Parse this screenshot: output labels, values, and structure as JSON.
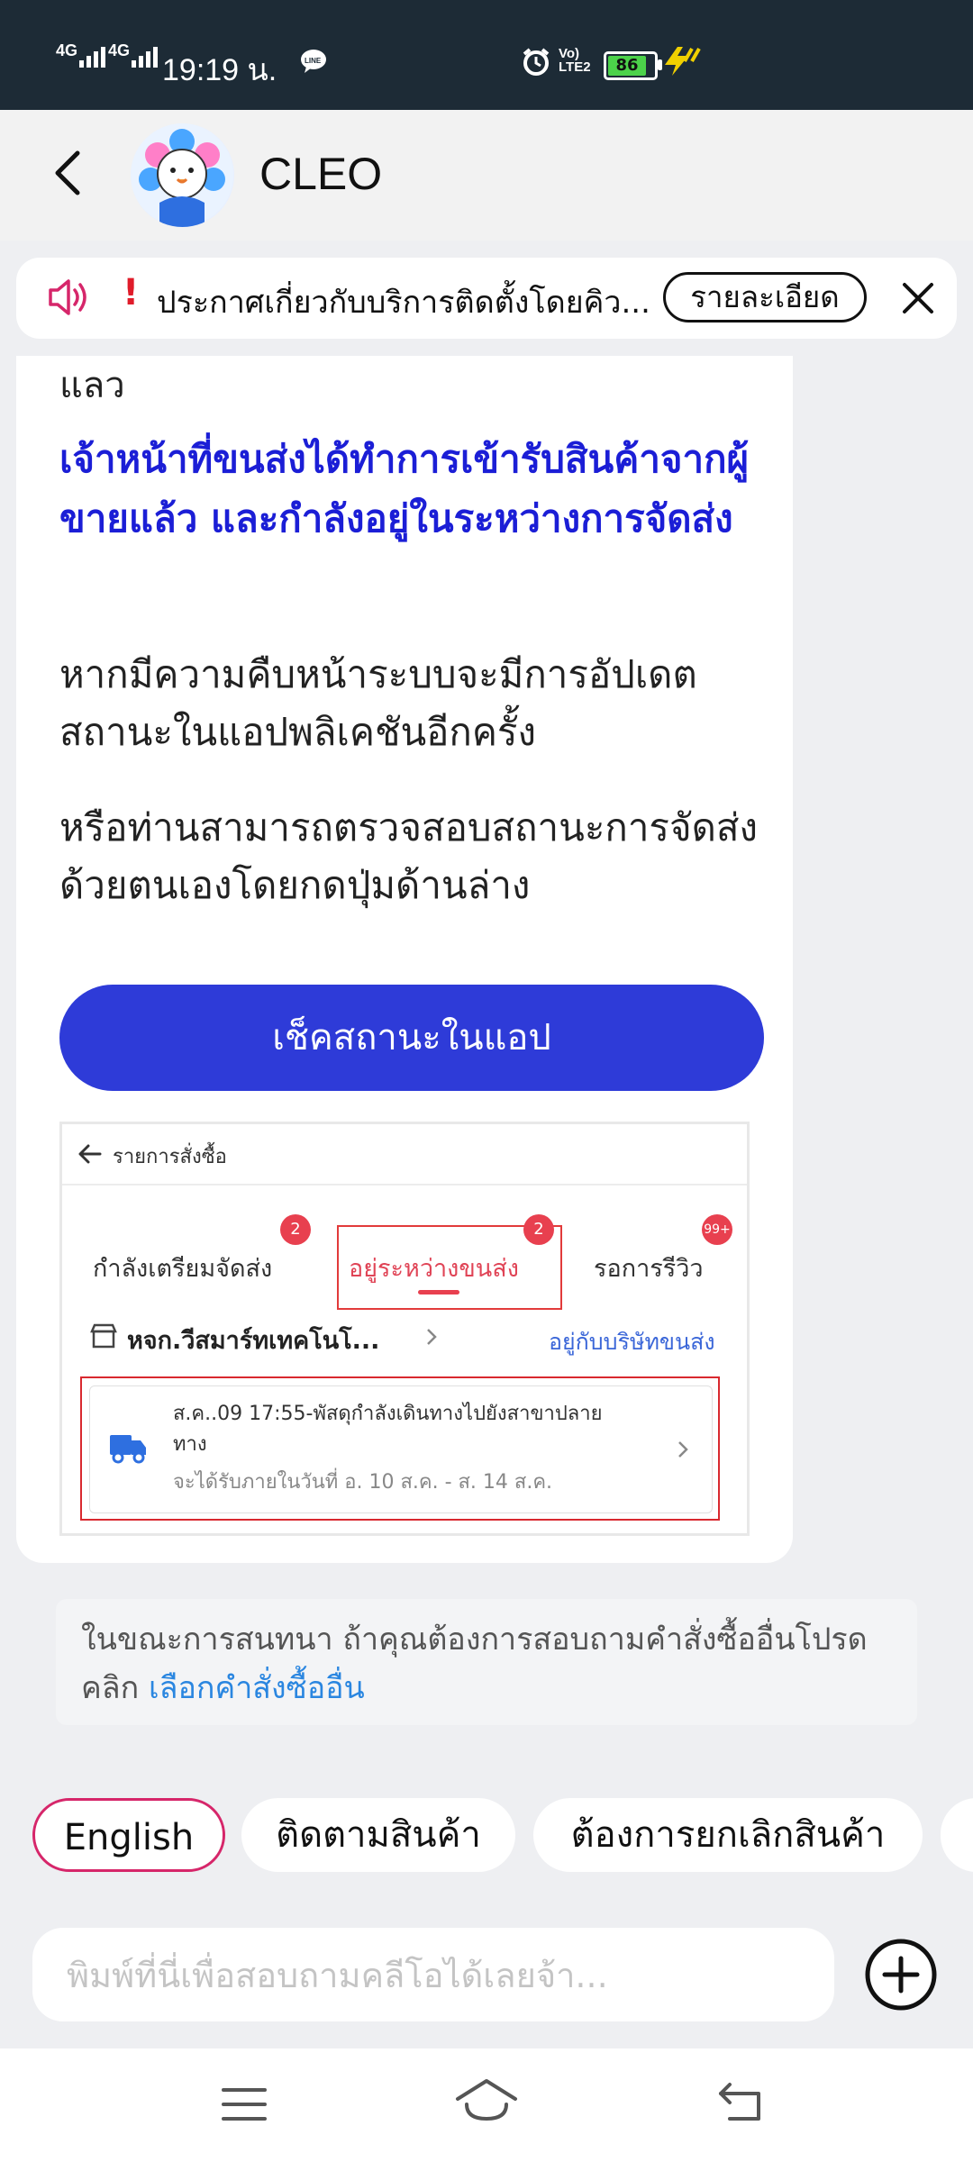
{
  "status_bar": {
    "net1": "4G",
    "net2": "4G",
    "time": "19:19 น.",
    "volte": "Vo) LTE2",
    "battery": "86"
  },
  "header": {
    "title": "CLEO"
  },
  "announcement": {
    "text": "ประกาศเกี่ยวกับบริการติดตั้งโดยคิว...",
    "detail_label": "รายละเอียด"
  },
  "chat": {
    "partial_top": "แลว",
    "blue_message": "เจ้าหน้าที่ขนส่งได้ทำการเข้ารับสินค้าจากผู้ขายแล้ว และกำลังอยู่ในระหว่างการจัดส่ง",
    "message_1": "หากมีความคืบหน้าระบบจะมีการอัปเดตสถานะในแอปพลิเคชันอีกครั้ง",
    "message_2": "หรือท่านสามารถตรวจสอบสถานะการจัดส่งด้วยตนเองโดยกดปุ่มด้านล่าง",
    "button_label": "เช็คสถานะในแอป"
  },
  "embedded": {
    "header_title": "รายการสั่งซื้อ",
    "tabs": [
      {
        "label": "กำลังเตรียมจัดส่ง",
        "badge": "2"
      },
      {
        "label": "อยู่ระหว่างขนส่ง",
        "badge": "2"
      },
      {
        "label": "รอการรีวิว",
        "badge": "99+"
      }
    ],
    "shop_name": "หจก.วีสมาร์ทเทคโนโ...",
    "shop_status": "อยู่กับบริษัทขนส่ง",
    "shipment_line1": "ส.ค..09 17:55-พัสดุกำลังเดินทางไปยังสาขาปลาย",
    "shipment_line2": "ทาง",
    "shipment_eta": "จะได้รับภายในวันที่ อ. 10 ส.ค. - ส. 14 ส.ค."
  },
  "note": {
    "text": "ในขณะการสนทนา ถ้าคุณต้องการสอบถามคำสั่งซื้ออื่นโปรดคลิก",
    "link": "เลือกคำสั่งซื้ออื่น"
  },
  "quick_replies": [
    "English",
    "ติดตามสินค้า",
    "ต้องการยกเลิกสินค้า"
  ],
  "input": {
    "placeholder": "พิมพ์ที่นี่เพื่อสอบถามคลีโอได้เลยจ้า..."
  },
  "colors": {
    "primary": "#2e3bd8",
    "blue_text": "#1b1ed6",
    "accent_pink": "#d6266a",
    "badge_red": "#e8404f"
  }
}
